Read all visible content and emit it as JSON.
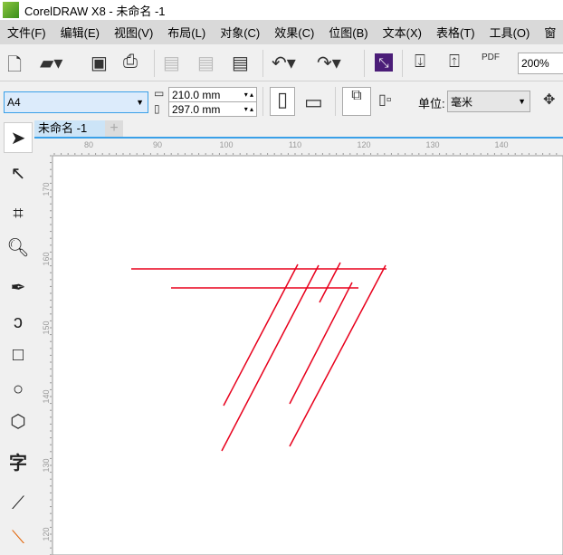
{
  "window": {
    "title": "CorelDRAW X8 - 未命名 -1"
  },
  "menu": [
    "文件(F)",
    "编辑(E)",
    "视图(V)",
    "布局(L)",
    "对象(C)",
    "效果(C)",
    "位图(B)",
    "文本(X)",
    "表格(T)",
    "工具(O)",
    "窗"
  ],
  "toolbar": {
    "zoom": "200%",
    "pdf_label": "PDF"
  },
  "property_bar": {
    "page_size": "A4",
    "width": "210.0 mm",
    "height": "297.0 mm",
    "units_label": "单位:",
    "units": "毫米"
  },
  "document_tab": {
    "name": "未命名 -1",
    "add": "+"
  },
  "ruler": {
    "h_labels": [
      "80",
      "90",
      "100",
      "110",
      "120",
      "130",
      "140"
    ],
    "v_labels": [
      "170",
      "160",
      "150",
      "140",
      "130",
      "120"
    ]
  },
  "toolbox": {
    "text_tool": "字"
  },
  "accent_color": "#e8001c"
}
